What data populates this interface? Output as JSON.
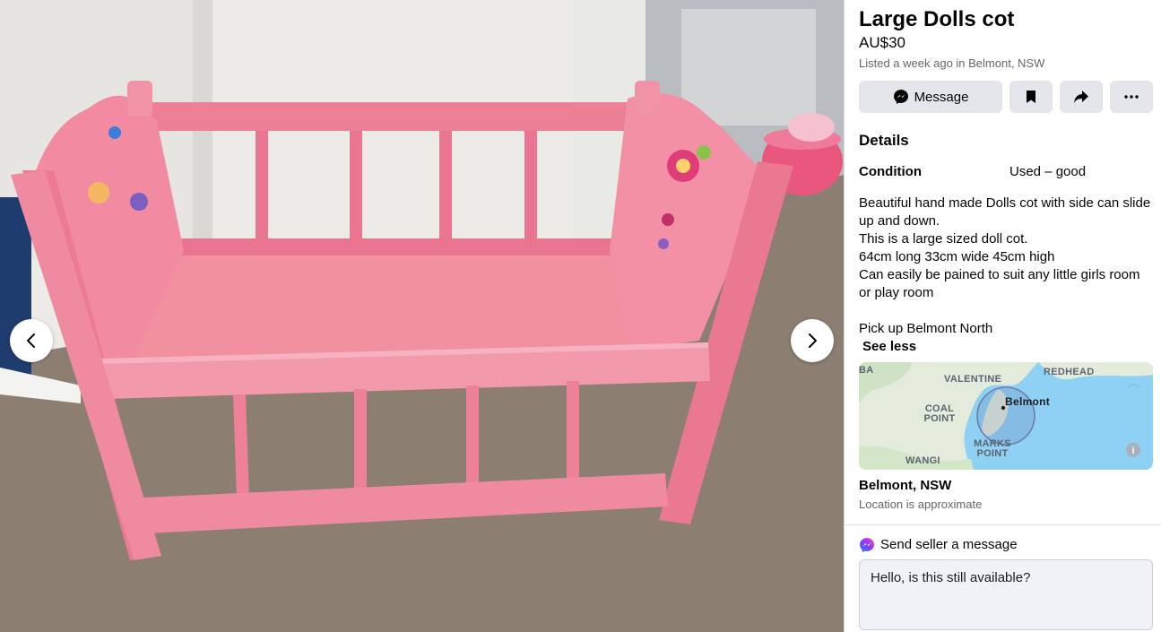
{
  "listing": {
    "title": "Large Dolls cot",
    "price": "AU$30",
    "meta": "Listed a week ago in Belmont, NSW"
  },
  "actions": {
    "message_label": "Message",
    "icons": [
      "messenger-icon",
      "bookmark-icon",
      "share-icon",
      "more-icon"
    ]
  },
  "details": {
    "heading": "Details",
    "condition_label": "Condition",
    "condition_value": "Used – good",
    "description": "Beautiful hand made Dolls cot with side can slide up and down.\nThis is a large sized doll cot.\n64cm long  33cm wide 45cm high\nCan easily be pained to suit any little girls room or play room\n\nPick up Belmont North",
    "see_less": "See less"
  },
  "map": {
    "labels": [
      "BA",
      "VALENTINE",
      "REDHEAD",
      "Belmont",
      "COAL POINT",
      "MARKS POINT",
      "WANGI"
    ],
    "water_color": "#8fd0f5",
    "land_color": "#e3ecdc"
  },
  "location": {
    "name": "Belmont, NSW",
    "note": "Location is approximate"
  },
  "send": {
    "heading": "Send seller a message",
    "message_value": "Hello, is this still available?"
  },
  "colors": {
    "cot_pink": "#f08aa0",
    "button_bg": "#e4e6eb"
  }
}
